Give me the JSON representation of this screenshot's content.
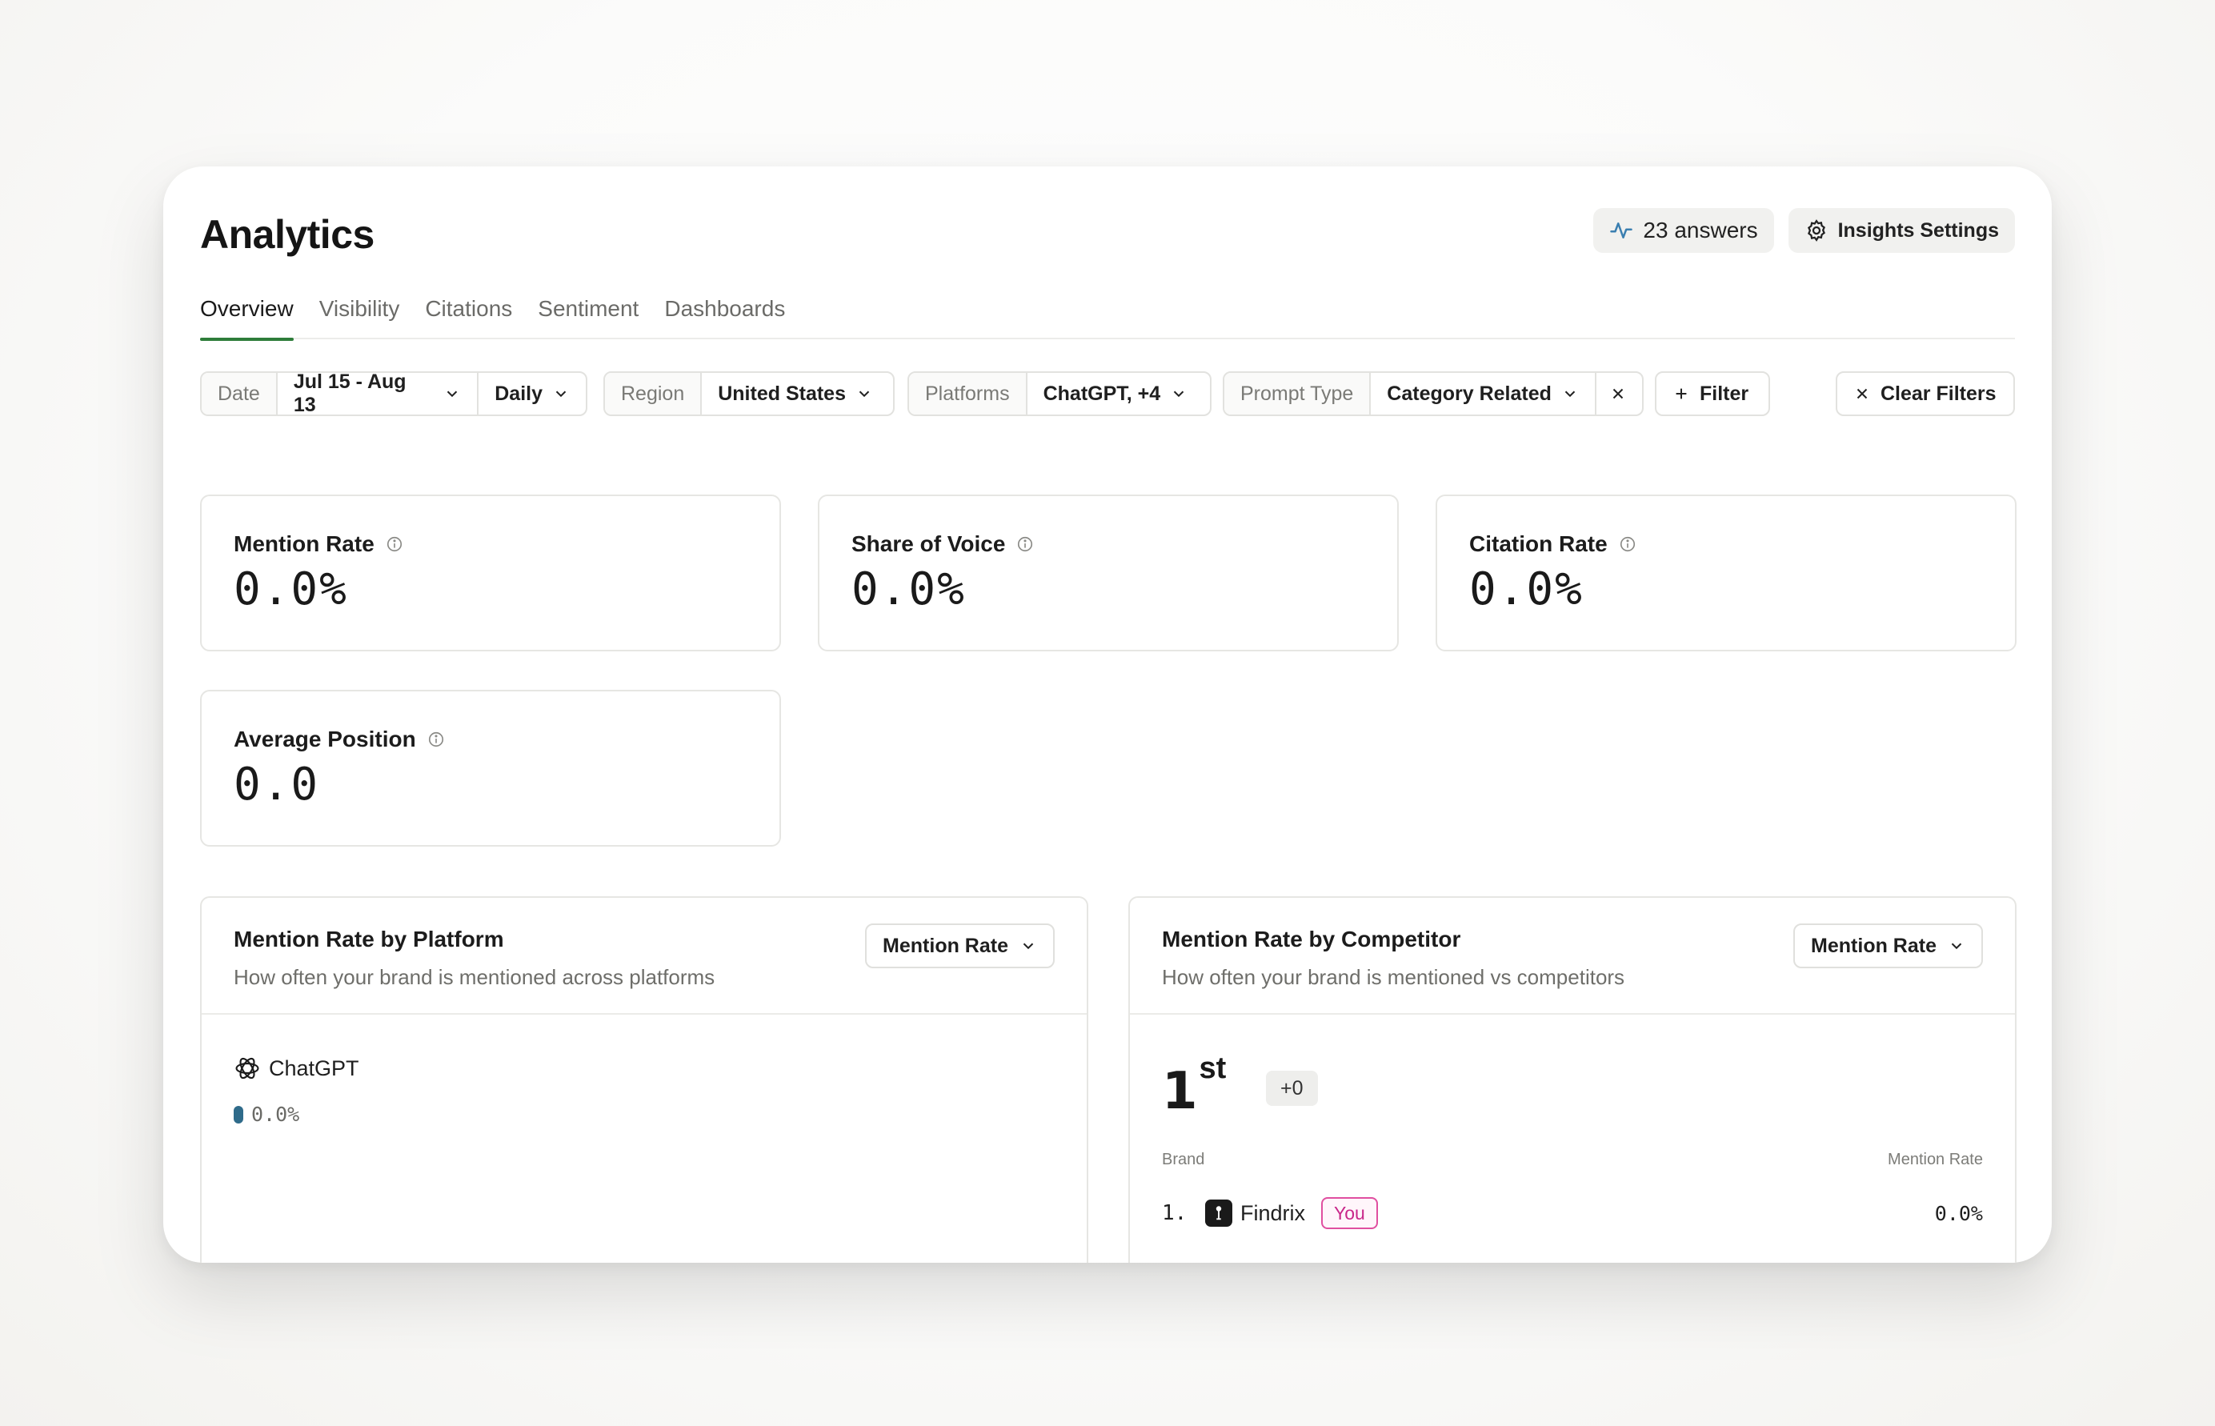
{
  "page": {
    "title": "Analytics",
    "answers_label": "23 answers",
    "settings_label": "Insights Settings"
  },
  "tabs": [
    {
      "label": "Overview",
      "active": true
    },
    {
      "label": "Visibility",
      "active": false
    },
    {
      "label": "Citations",
      "active": false
    },
    {
      "label": "Sentiment",
      "active": false
    },
    {
      "label": "Dashboards",
      "active": false
    }
  ],
  "filters": {
    "date": {
      "label": "Date",
      "range": "Jul 15 - Aug 13",
      "granularity": "Daily"
    },
    "region": {
      "label": "Region",
      "value": "United States"
    },
    "platforms": {
      "label": "Platforms",
      "value": "ChatGPT, +4"
    },
    "prompt_type": {
      "label": "Prompt Type",
      "value": "Category Related"
    },
    "add_filter_label": "Filter",
    "clear_label": "Clear Filters"
  },
  "metrics": [
    {
      "title": "Mention Rate",
      "value": "0.0%"
    },
    {
      "title": "Share of Voice",
      "value": "0.0%"
    },
    {
      "title": "Citation Rate",
      "value": "0.0%"
    },
    {
      "title": "Average Position",
      "value": "0.0"
    }
  ],
  "platform_panel": {
    "title": "Mention Rate by Platform",
    "subtitle": "How often your brand is mentioned across platforms",
    "select": "Mention Rate",
    "rows": [
      {
        "name": "ChatGPT",
        "value": "0.0%",
        "fraction": 0.0
      }
    ]
  },
  "competitor_panel": {
    "title": "Mention Rate by Competitor",
    "subtitle": "How often your brand is mentioned vs competitors",
    "select": "Mention Rate",
    "rank_number": "1",
    "rank_suffix": "st",
    "rank_delta": "+0",
    "col_brand": "Brand",
    "col_rate": "Mention Rate",
    "rows": [
      {
        "index": "1.",
        "name": "Findrix",
        "badge": "You",
        "value": "0.0%"
      }
    ]
  },
  "colors": {
    "tab_active": "#2e7d3a",
    "you_badge": "#c9278a",
    "bar": "#2f6b8a",
    "activity_icon": "#3b7fb0"
  }
}
